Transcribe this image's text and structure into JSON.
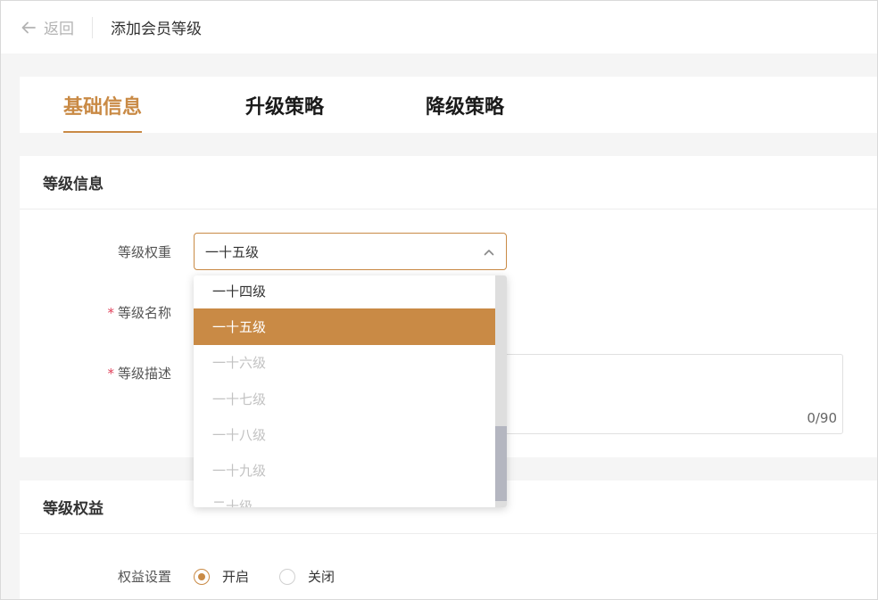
{
  "header": {
    "back_label": "返回",
    "title": "添加会员等级"
  },
  "tabs": [
    {
      "label": "基础信息",
      "active": true
    },
    {
      "label": "升级策略",
      "active": false
    },
    {
      "label": "降级策略",
      "active": false
    }
  ],
  "level_info": {
    "section_title": "等级信息",
    "weight_label": "等级权重",
    "weight_value": "一十五级",
    "name_label": "等级名称",
    "desc_label": "等级描述",
    "desc_counter": "0/90",
    "required_mark": "*"
  },
  "dropdown": {
    "options": [
      {
        "label": "一十四级",
        "state": "normal"
      },
      {
        "label": "一十五级",
        "state": "selected"
      },
      {
        "label": "一十六级",
        "state": "disabled"
      },
      {
        "label": "一十七级",
        "state": "disabled"
      },
      {
        "label": "一十八级",
        "state": "disabled"
      },
      {
        "label": "一十九级",
        "state": "disabled"
      },
      {
        "label": "二十级",
        "state": "disabled"
      }
    ]
  },
  "benefits": {
    "section_title": "等级权益",
    "setting_label": "权益设置",
    "options": [
      {
        "label": "开启",
        "checked": true
      },
      {
        "label": "关闭",
        "checked": false
      }
    ]
  },
  "colors": {
    "accent": "#c98a45",
    "required": "#e0405a",
    "disabled_text": "#c2c2c2"
  }
}
